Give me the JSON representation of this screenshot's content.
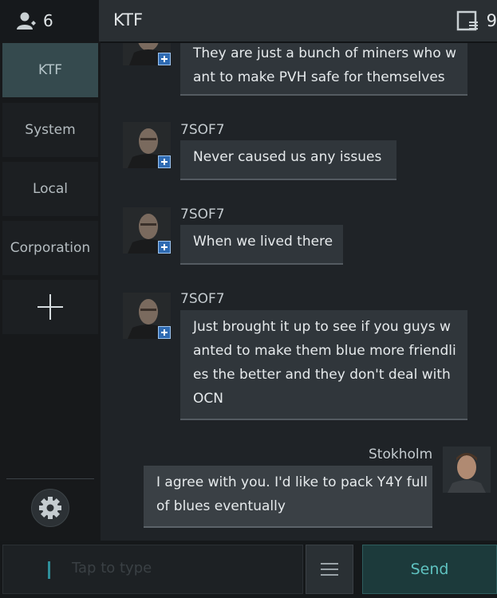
{
  "header": {
    "member_count": "6",
    "channel_title": "KTF",
    "message_count": "9",
    "icons": {
      "members": "person-icon",
      "messages": "chat-window-icon"
    }
  },
  "sidebar": {
    "items": [
      {
        "label": "KTF",
        "active": true
      },
      {
        "label": "System",
        "active": false
      },
      {
        "label": "Local",
        "active": false
      },
      {
        "label": "Corporation",
        "active": false
      }
    ],
    "add_icon": "plus-icon",
    "settings_icon": "gear-icon"
  },
  "messages": [
    {
      "sender": "",
      "lines": [
        "They are just a bunch of miners who w",
        "ant to make PVH safe for themselves"
      ]
    },
    {
      "sender": "7SOF7",
      "lines": [
        "Never caused us any issues"
      ]
    },
    {
      "sender": "7SOF7",
      "lines": [
        "When we lived there"
      ]
    },
    {
      "sender": "7SOF7",
      "lines": [
        "Just brought it up to see if you guys w",
        "anted to make them blue more friendli",
        "es the better and they don't deal with",
        "OCN"
      ]
    },
    {
      "sender": "Stokholm",
      "lines": [
        "I agree with you. I'd like to pack Y4Y full",
        "of blues eventually"
      ]
    }
  ],
  "composer": {
    "placeholder": "Tap to type",
    "send_label": "Send",
    "list_icon": "list-icon"
  },
  "colors": {
    "accent": "#5fc2c0",
    "active_tab": "#354a4e",
    "corp_badge": "#2f6bb3"
  }
}
